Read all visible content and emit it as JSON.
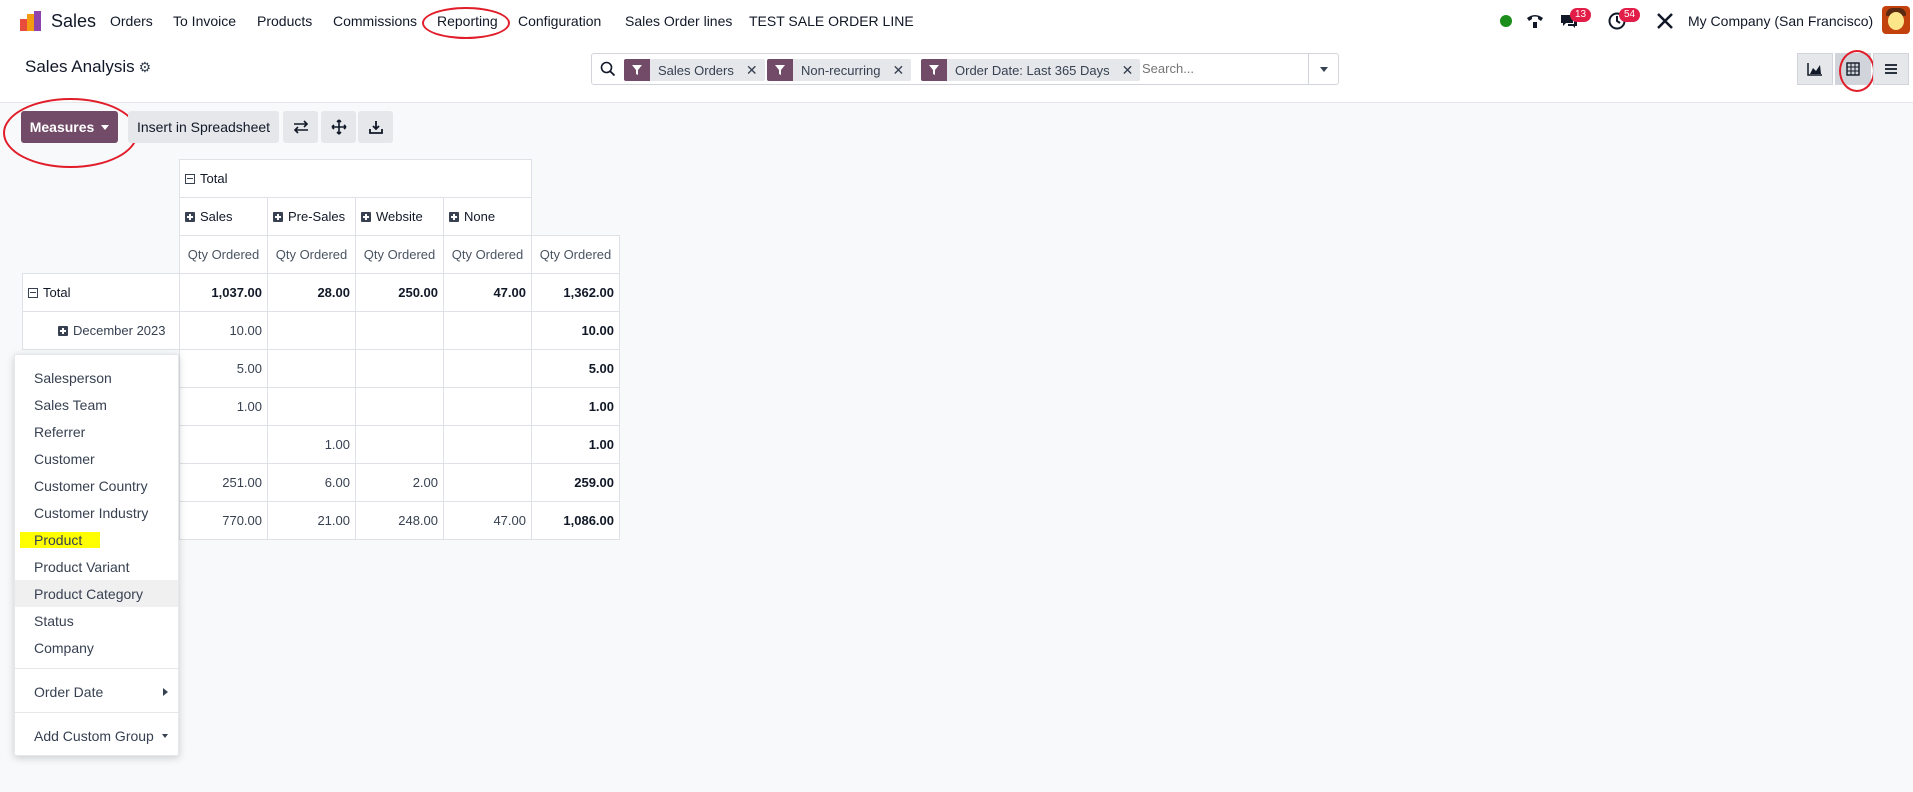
{
  "navbar": {
    "app_name": "Sales",
    "menu": [
      "Orders",
      "To Invoice",
      "Products",
      "Commissions",
      "Reporting",
      "Configuration",
      "Sales Order lines",
      "TEST SALE ORDER LINE"
    ],
    "chat_badge": "13",
    "activity_badge": "54",
    "company": "My Company (San Francisco)"
  },
  "control": {
    "breadcrumb": "Sales Analysis",
    "facets": [
      "Sales Orders",
      "Non-recurring",
      "Order Date: Last 365 Days"
    ],
    "search_placeholder": "Search..."
  },
  "toolbar": {
    "measures_label": "Measures",
    "insert_label": "Insert in Spreadsheet"
  },
  "pivot": {
    "col_header_total": "Total",
    "col_groups": [
      "Sales",
      "Pre-Sales",
      "Website",
      "None"
    ],
    "measure": "Qty Ordered",
    "row_total_label": "Total",
    "row_child_label": "December 2023",
    "rows": [
      [
        "1,037.00",
        "28.00",
        "250.00",
        "47.00",
        "1,362.00"
      ],
      [
        "10.00",
        "",
        "",
        "",
        "10.00"
      ],
      [
        "5.00",
        "",
        "",
        "",
        "5.00"
      ],
      [
        "1.00",
        "",
        "",
        "",
        "1.00"
      ],
      [
        "",
        "1.00",
        "",
        "",
        "1.00"
      ],
      [
        "251.00",
        "6.00",
        "2.00",
        "",
        "259.00"
      ],
      [
        "770.00",
        "21.00",
        "248.00",
        "47.00",
        "1,086.00"
      ]
    ]
  },
  "groupby_menu": {
    "items": [
      "Salesperson",
      "Sales Team",
      "Referrer",
      "Customer",
      "Customer Country",
      "Customer Industry",
      "Product",
      "Product Variant",
      "Product Category",
      "Status",
      "Company"
    ],
    "order_date": "Order Date",
    "custom_group": "Add Custom Group"
  },
  "colors": {
    "primary": "#714b67",
    "annotation": "#e11d2a",
    "highlight": "#ffff00",
    "badge": "#e11d48",
    "online": "#1a8d1a"
  }
}
